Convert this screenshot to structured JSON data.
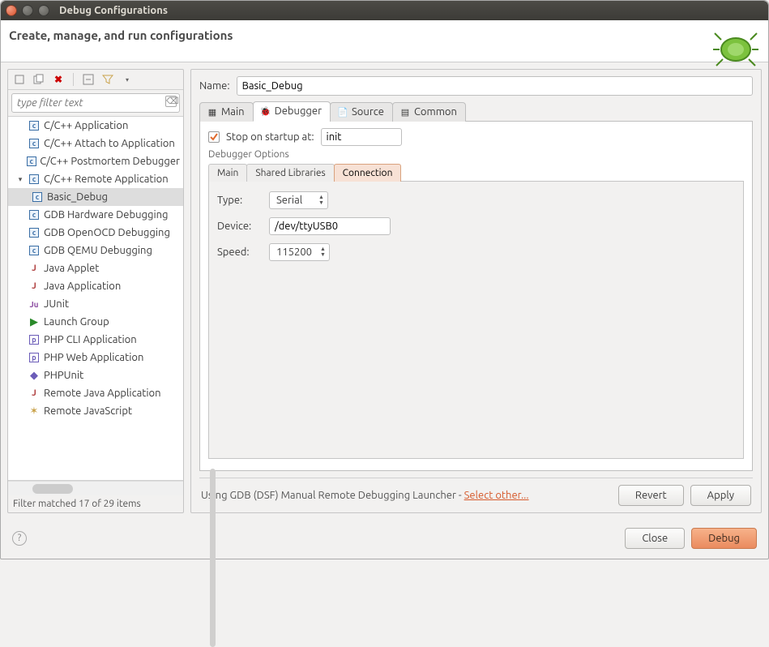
{
  "window": {
    "title": "Debug Configurations"
  },
  "header": {
    "headline": "Create, manage, and run configurations"
  },
  "filter": {
    "placeholder": "type filter text"
  },
  "tree": {
    "items": [
      {
        "label": "C/C++ Application",
        "ic": "c"
      },
      {
        "label": "C/C++ Attach to Application",
        "ic": "c"
      },
      {
        "label": "C/C++ Postmortem Debugger",
        "ic": "c"
      },
      {
        "label": "C/C++ Remote Application",
        "ic": "c",
        "expanded": true,
        "children": [
          {
            "label": "Basic_Debug",
            "ic": "c",
            "selected": true
          }
        ]
      },
      {
        "label": "GDB Hardware Debugging",
        "ic": "c"
      },
      {
        "label": "GDB OpenOCD Debugging",
        "ic": "c"
      },
      {
        "label": "GDB QEMU Debugging",
        "ic": "c"
      },
      {
        "label": "Java Applet",
        "ic": "j"
      },
      {
        "label": "Java Application",
        "ic": "j"
      },
      {
        "label": "JUnit",
        "ic": "ju"
      },
      {
        "label": "Launch Group",
        "ic": "lg"
      },
      {
        "label": "PHP CLI Application",
        "ic": "php"
      },
      {
        "label": "PHP Web Application",
        "ic": "php"
      },
      {
        "label": "PHPUnit",
        "ic": "phpu"
      },
      {
        "label": "Remote Java Application",
        "ic": "j"
      },
      {
        "label": "Remote JavaScript",
        "ic": "js"
      }
    ],
    "filter_status": "Filter matched 17 of 29 items"
  },
  "form": {
    "name_label": "Name:",
    "name_value": "Basic_Debug",
    "tabs": {
      "main": "Main",
      "debugger": "Debugger",
      "source": "Source",
      "common": "Common"
    },
    "stop_label": "Stop on startup at:",
    "stop_value": "init",
    "group_title": "Debugger Options",
    "subtabs": {
      "main": "Main",
      "shared": "Shared Libraries",
      "connection": "Connection"
    },
    "type_label": "Type:",
    "type_value": "Serial",
    "device_label": "Device:",
    "device_value": "/dev/ttyUSB0",
    "speed_label": "Speed:",
    "speed_value": "115200",
    "launcher_prefix": "Using GDB (DSF) Manual Remote Debugging Launcher - ",
    "launcher_link": "Select other...",
    "revert": "Revert",
    "apply": "Apply"
  },
  "footer": {
    "close": "Close",
    "debug": "Debug"
  }
}
